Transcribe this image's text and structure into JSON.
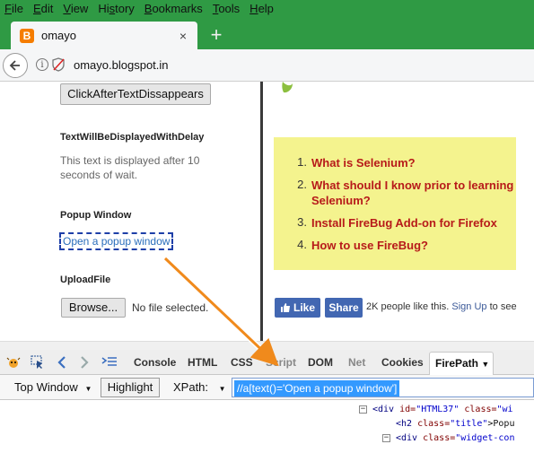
{
  "menubar": {
    "items": [
      {
        "pre": "",
        "ul": "F",
        "post": "ile"
      },
      {
        "pre": "",
        "ul": "E",
        "post": "dit"
      },
      {
        "pre": "",
        "ul": "V",
        "post": "iew"
      },
      {
        "pre": "Hi",
        "ul": "s",
        "post": "tory"
      },
      {
        "pre": "",
        "ul": "B",
        "post": "ookmarks"
      },
      {
        "pre": "",
        "ul": "T",
        "post": "ools"
      },
      {
        "pre": "",
        "ul": "H",
        "post": "elp"
      }
    ]
  },
  "tab": {
    "title": "omayo",
    "favicon": "B",
    "close": "×",
    "newtab": "+"
  },
  "navbar": {
    "url": "omayo.blogspot.in"
  },
  "page": {
    "button_label": "ClickAfterTextDissappears",
    "delay_heading": "TextWillBeDisplayedWithDelay",
    "delay_text": "This text is displayed after 10 seconds of wait.",
    "popup_heading": "Popup Window",
    "popup_link": "Open a popup window",
    "upload_heading": "UploadFile",
    "browse_label": "Browse...",
    "no_file": "No file selected."
  },
  "sidebar_links": [
    {
      "num": "1.",
      "text": "What is Selenium?"
    },
    {
      "num": "2.",
      "text": "What should I know prior to learning",
      "text2": "Selenium?"
    },
    {
      "num": "3.",
      "text": "Install FireBug Add-on for Firefox"
    },
    {
      "num": "4.",
      "text": "How to use FireBug?"
    }
  ],
  "facebook": {
    "like": "Like",
    "share": "Share",
    "count_text": "2K people like this.",
    "signup": "Sign Up",
    "tail": "to see"
  },
  "firebug": {
    "tabs": [
      "Console",
      "HTML",
      "CSS",
      "Script",
      "DOM",
      "Net",
      "Cookies"
    ],
    "active_tab": "FirePath",
    "top_window": "Top Window",
    "highlight": "Highlight",
    "xpath_label": "XPath:",
    "xpath_value": "//a[text()='Open a popup window']"
  },
  "html_panel": {
    "line1": {
      "tag": "<div",
      "a1": "id=",
      "v1": "\"HTML37\"",
      "a2": "class=",
      "v2": "\"wi"
    },
    "line2": {
      "tag": "<h2",
      "a1": "class=",
      "v1": "\"title\"",
      "text": ">Popu"
    },
    "line3": {
      "tag": "<div",
      "a1": "class=",
      "v1": "\"widget-con"
    }
  },
  "colors": {
    "menubar": "#2f9a44",
    "link_red": "#b71a1a",
    "yellow": "#f4f38e",
    "fb_blue": "#4267b2",
    "arrow": "#f08a1c"
  }
}
